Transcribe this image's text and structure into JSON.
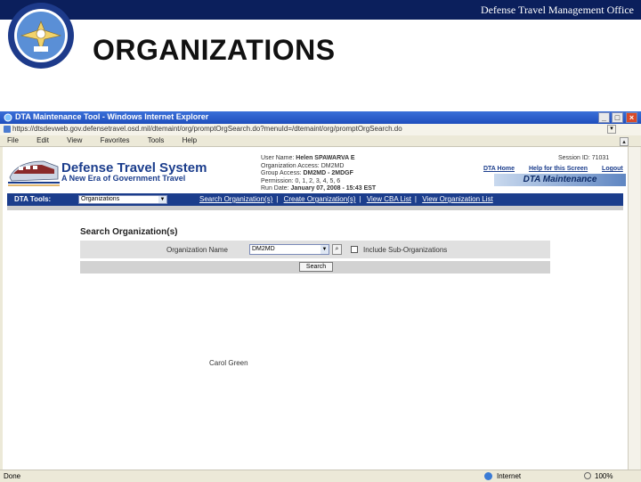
{
  "slide": {
    "org_name": "Defense Travel Management Office",
    "title": "ORGANIZATIONS"
  },
  "browser": {
    "window_title": "DTA Maintenance Tool - Windows Internet Explorer",
    "url": "https://dtsdevweb.gov.defensetravel.osd.mil/dtemaint/org/promptOrgSearch.do?menuId=/dtemaint/org/promptOrgSearch.do",
    "menu": [
      "File",
      "Edit",
      "View",
      "Favorites",
      "Tools",
      "Help"
    ],
    "status": "Done",
    "zone": "Internet",
    "zoom": "100%"
  },
  "dts": {
    "name": "Defense Travel System",
    "tagline": "A New Era of Government Travel",
    "user_lines": [
      {
        "label": "User Name:",
        "value": "Helen SPAWARVA E"
      },
      {
        "label": "Organization Access:",
        "value": "DM2MD"
      },
      {
        "label": "Group Access:",
        "value": "DM2MD - 2MDGF"
      },
      {
        "label": "Permission:",
        "value": "0, 1, 2, 3, 4, 5, 6"
      },
      {
        "label": "Run Date:",
        "value": "January 07, 2008 - 15:43 EST"
      }
    ],
    "session": "Session ID: 71031",
    "links": [
      "DTA Home",
      "Help for this Screen",
      "Logout"
    ],
    "banner": "DTA Maintenance",
    "tools_label": "DTA Tools:",
    "tools_selected": "Organizations",
    "nav": [
      "Search Organization(s)",
      "Create Organization(s)",
      "View CBA List",
      "View Organization List"
    ]
  },
  "search": {
    "title": "Search Organization(s)",
    "org_label": "Organization Name",
    "org_value": "DM2MD",
    "include_label": "Include Sub-Organizations",
    "button": "Search"
  },
  "signature": "Carol Green",
  "colors": {
    "header_band": "#0b1f5c",
    "dts_blue": "#1b3d8c",
    "titlebar": "#2a5fcf"
  }
}
